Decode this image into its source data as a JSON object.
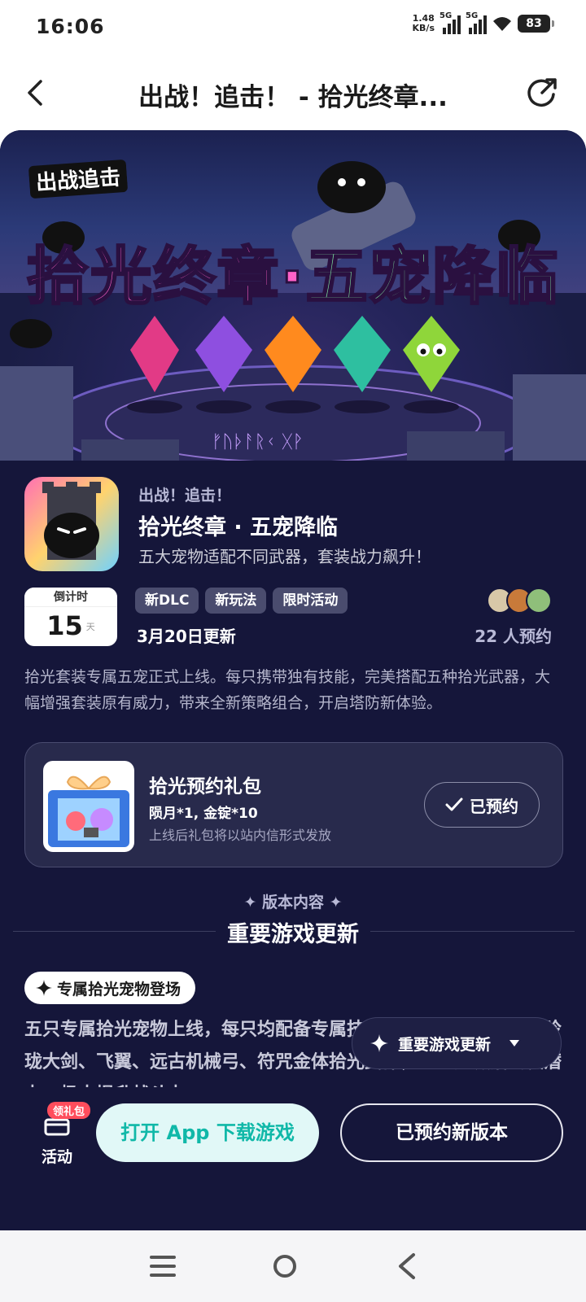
{
  "status_bar": {
    "time": "16:06",
    "net_speed_value": "1.48",
    "net_speed_unit": "KB/s",
    "signal1_label": "5G",
    "signal2_label": "5G",
    "battery": "83"
  },
  "header": {
    "title": "出战！追击！ - 拾光终章..."
  },
  "banner": {
    "logo_text": "出战追击",
    "headline_a": "拾光终章·",
    "headline_b": "五宠降临"
  },
  "app": {
    "subtitle": "出战！追击！",
    "name": "拾光终章 · 五宠降临",
    "slogan": "五大宠物适配不同武器，套装战力飙升！",
    "countdown_label": "倒计时",
    "countdown_value": "15",
    "countdown_unit": "天",
    "tags": [
      "新DLC",
      "新玩法",
      "限时活动"
    ],
    "update_date": "3月20日更新",
    "reserve_count": "22 人预约",
    "description": "拾光套装专属五宠正式上线。每只携带独有技能，完美搭配五种拾光武器，大幅增强套装原有威力，带来全新策略组合，开启塔防新体验。"
  },
  "gift": {
    "title": "拾光预约礼包",
    "detail": "陨月*1, 金锭*10",
    "note": "上线后礼包将以站内信形式发放",
    "button_label": "已预约"
  },
  "section": {
    "label": "✦ 版本内容 ✦",
    "title": "重要游戏更新",
    "pill": "专属拾光宠物登场",
    "body": "五只专属拾光宠物上线，每只均配备专属技能，可搭配上古钩斧、玲珑大剑、飞翼、远古机械弓、符咒金体拾光武器，进一步激活套装潜力，极大提升战斗力。"
  },
  "float_button": {
    "label": "重要游戏更新"
  },
  "bottom": {
    "activity_label": "活动",
    "badge": "领礼包",
    "open_app": "打开 App 下载游戏",
    "reserved_version": "已预约新版本"
  },
  "colors": {
    "background": "#15163a",
    "accent_teal": "#10b8a8",
    "badge_red": "#ff4d5c"
  }
}
